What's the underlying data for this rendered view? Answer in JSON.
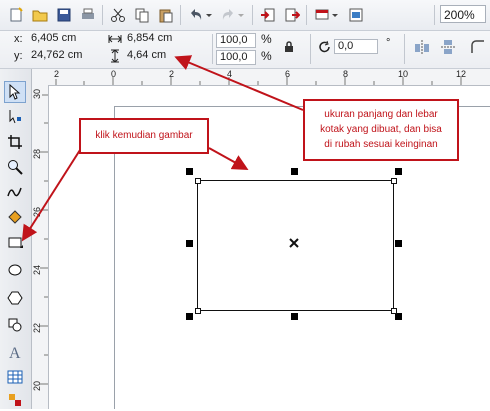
{
  "toolbar": {
    "icons": [
      "new-document-icon",
      "open-icon",
      "save-icon",
      "print-icon",
      "cut-icon",
      "copy-icon",
      "paste-icon",
      "undo-icon",
      "redo-icon",
      "import-icon",
      "export-icon",
      "app-launcher-icon",
      "welcome-screen-icon"
    ],
    "zoom": "200%"
  },
  "property_bar": {
    "x_label": "x:",
    "x_value": "6,405 cm",
    "y_label": "y:",
    "y_value": "24,762 cm",
    "width_value": "6,854 cm",
    "height_value": "4,64 cm",
    "scale_x": "100,0",
    "scale_y": "100,0",
    "percent": "%",
    "rotation_value": "0,0",
    "degree": "°"
  },
  "rulers": {
    "horizontal_ticks": [
      "2",
      "0",
      "2",
      "4",
      "6",
      "8",
      "10",
      "12"
    ],
    "vertical_ticks": [
      "30",
      "28",
      "26",
      "24",
      "22",
      "20"
    ]
  },
  "toolbox": {
    "tools": [
      "pick-tool-icon",
      "shape-tool-icon",
      "crop-tool-icon",
      "zoom-tool-icon",
      "freehand-tool-icon",
      "smart-fill-icon",
      "rectangle-tool-icon",
      "ellipse-tool-icon",
      "polygon-tool-icon",
      "basic-shapes-icon",
      "text-tool-icon",
      "table-tool-icon",
      "dimension-tool-icon"
    ]
  },
  "annotations": {
    "callout_left": "klik kemudian gambar",
    "callout_right_line1": "ukuran panjang dan lebar",
    "callout_right_line2": "kotak yang dibuat, dan bisa",
    "callout_right_line3": "di rubah sesuai keinginan"
  },
  "colors": {
    "annotation_red": "#c0131a",
    "toolbar_bg": "#eceef2"
  }
}
